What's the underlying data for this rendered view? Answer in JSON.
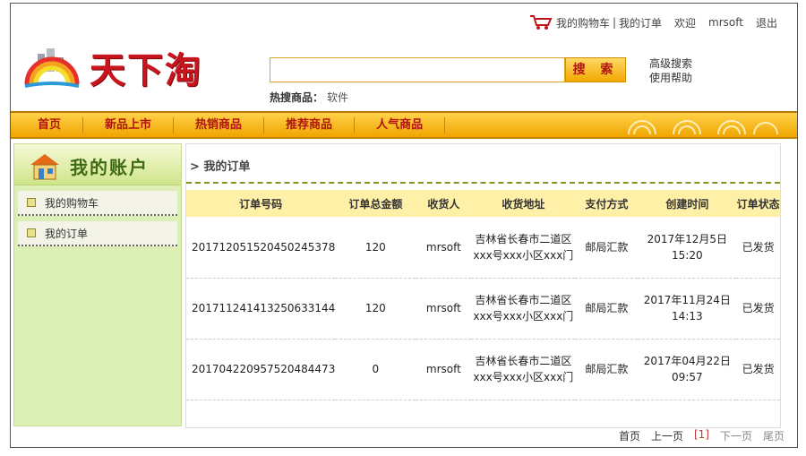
{
  "header": {
    "cart_label": "我的购物车",
    "separator": "|",
    "orders_label": "我的订单",
    "welcome": "欢迎",
    "username": "mrsoft",
    "logout": "退出"
  },
  "logo": {
    "text": "天下淘"
  },
  "search": {
    "value": "",
    "button_label": "搜 索",
    "hot_label": "热搜商品：",
    "hot_keyword": "软件",
    "advanced": "高级搜索",
    "help": "使用帮助"
  },
  "nav": {
    "items": [
      {
        "label": "首页"
      },
      {
        "label": "新品上市"
      },
      {
        "label": "热销商品"
      },
      {
        "label": "推荐商品"
      },
      {
        "label": "人气商品"
      }
    ]
  },
  "sidebar": {
    "title": "我的账户",
    "items": [
      {
        "label": "我的购物车"
      },
      {
        "label": "我的订单"
      }
    ]
  },
  "main": {
    "breadcrumb": "> 我的订单",
    "columns": [
      "订单号码",
      "订单总金额",
      "收货人",
      "收货地址",
      "支付方式",
      "创建时间",
      "订单状态"
    ],
    "rows": [
      {
        "order_no": "201712051520450245378",
        "amount": "120",
        "receiver": "mrsoft",
        "addr1": "吉林省长春市二道区",
        "addr2": "xxx号xxx小区xxx门",
        "payment": "邮局汇款",
        "date": "2017年12月5日",
        "time": "15:20",
        "status": "已发货"
      },
      {
        "order_no": "201711241413250633144",
        "amount": "120",
        "receiver": "mrsoft",
        "addr1": "吉林省长春市二道区",
        "addr2": "xxx号xxx小区xxx门",
        "payment": "邮局汇款",
        "date": "2017年11月24日",
        "time": "14:13",
        "status": "已发货"
      },
      {
        "order_no": "201704220957520484473",
        "amount": "0",
        "receiver": "mrsoft",
        "addr1": "吉林省长春市二道区",
        "addr2": "xxx号xxx小区xxx门",
        "payment": "邮局汇款",
        "date": "2017年04月22日",
        "time": "09:57",
        "status": "已发货"
      }
    ]
  },
  "pager": {
    "first": "首页",
    "prev": "上一页",
    "current": "[1]",
    "next": "下一页",
    "last": "尾页"
  },
  "colors": {
    "brand_red": "#c8141c",
    "nav_yellow": "#f0a500",
    "sidebar_green": "#dcefb4",
    "table_header": "#fff0a8"
  }
}
